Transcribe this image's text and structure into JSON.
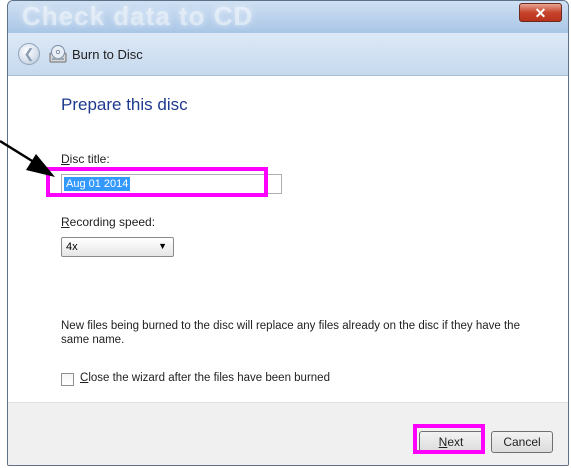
{
  "window": {
    "title": "Check data to CD",
    "close_glyph": "✕"
  },
  "nav": {
    "back_icon": "back-arrow-icon",
    "title": "Burn to Disc"
  },
  "content": {
    "heading": "Prepare this disc",
    "disc_title": {
      "label_access": "D",
      "label_rest": "isc title:",
      "value": "Aug 01 2014"
    },
    "recording_speed": {
      "label_access": "R",
      "label_rest": "ecording speed:",
      "selected": "4x"
    },
    "info_text": "New files being burned to the disc will replace any files already on the disc if they have the same name.",
    "close_wizard": {
      "checked": false,
      "label_access": "C",
      "label_rest": "lose the wizard after the files have been burned"
    }
  },
  "footer": {
    "next_access": "N",
    "next_rest": "ext",
    "cancel_label": "Cancel"
  },
  "annotations": {
    "highlight_color": "#ff00ff",
    "arrow_color": "#000000"
  }
}
